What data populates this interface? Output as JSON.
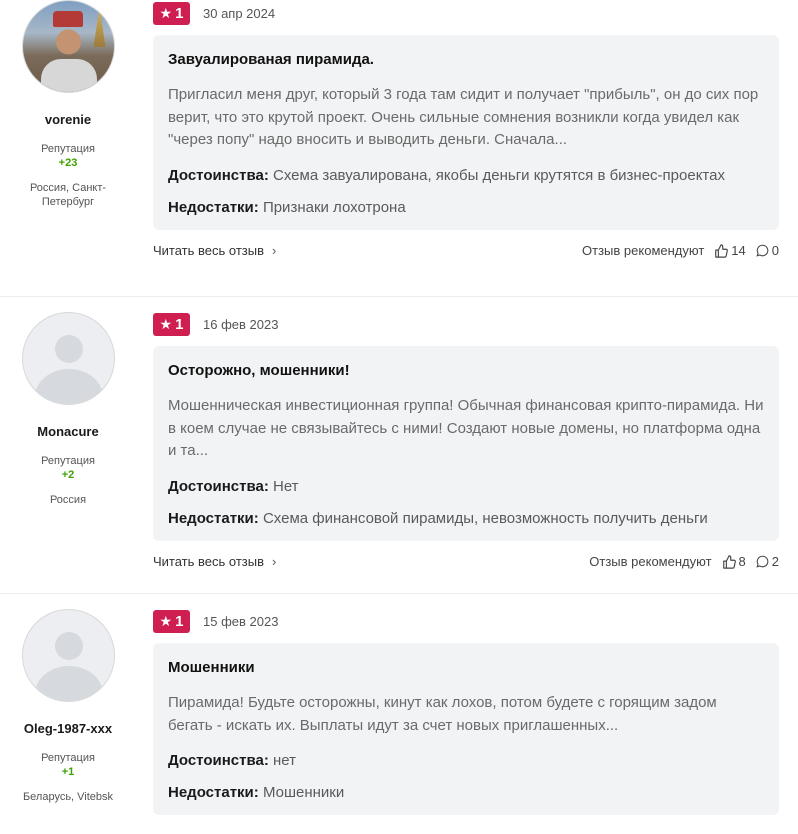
{
  "reviews": [
    {
      "author": {
        "name": "vorenie",
        "reputation_label": "Репутация",
        "reputation": "+23",
        "location": "Россия, Санкт-Петербург",
        "avatar": "photo"
      },
      "rating": "1",
      "date": "30 апр 2024",
      "title": "Завуалированая пирамида.",
      "text": "Пригласил меня друг, который 3 года там сидит и получает \"прибыль\", он до сих пор верит, что это крутой проект. Очень сильные сомнения возникли когда увидел как \"через попу\" надо вносить и выводить деньги. Сначала...",
      "pros_label": "Достоинства:",
      "pros": "Схема завуалирована, якобы деньги крутятся в бизнес-проектах",
      "cons_label": "Недостатки:",
      "cons": "Признаки лохотрона",
      "read_more": "Читать весь отзыв",
      "recommend_label": "Отзыв рекомендуют",
      "likes": "14",
      "comments": "0"
    },
    {
      "author": {
        "name": "Monacure",
        "reputation_label": "Репутация",
        "reputation": "+2",
        "location": "Россия",
        "avatar": "placeholder"
      },
      "rating": "1",
      "date": "16 фев 2023",
      "title": "Осторожно, мошенники!",
      "text": "Мошенническая инвестиционная группа! Обычная финансовая крипто-пирамида. Ни в коем случае не связывайтесь с ними! Создают новые домены, но платформа одна и та...",
      "pros_label": "Достоинства:",
      "pros": "Нет",
      "cons_label": "Недостатки:",
      "cons": "Схема финансовой пирамиды, невозможность получить деньги",
      "read_more": "Читать весь отзыв",
      "recommend_label": "Отзыв рекомендуют",
      "likes": "8",
      "comments": "2"
    },
    {
      "author": {
        "name": "Oleg-1987-xxx",
        "reputation_label": "Репутация",
        "reputation": "+1",
        "location": "Беларусь, Vitebsk",
        "avatar": "placeholder"
      },
      "rating": "1",
      "date": "15 фев 2023",
      "title": "Мошенники",
      "text": "Пирамида! Будьте осторожны, кинут как лохов, потом будете с горящим задом бегать - искать их. Выплаты идут за счет новых приглашенных...",
      "pros_label": "Достоинства:",
      "pros": "нет",
      "cons_label": "Недостатки:",
      "cons": "Мошенники"
    }
  ],
  "colors": {
    "rating_badge": "#cf1f50",
    "reputation": "#3fa200",
    "card_bg": "#f2f3f5"
  },
  "icons": {
    "rating": "star-icon",
    "likes": "thumbs-up-icon",
    "comments": "comment-icon",
    "read_more": "chevron-right-icon"
  }
}
